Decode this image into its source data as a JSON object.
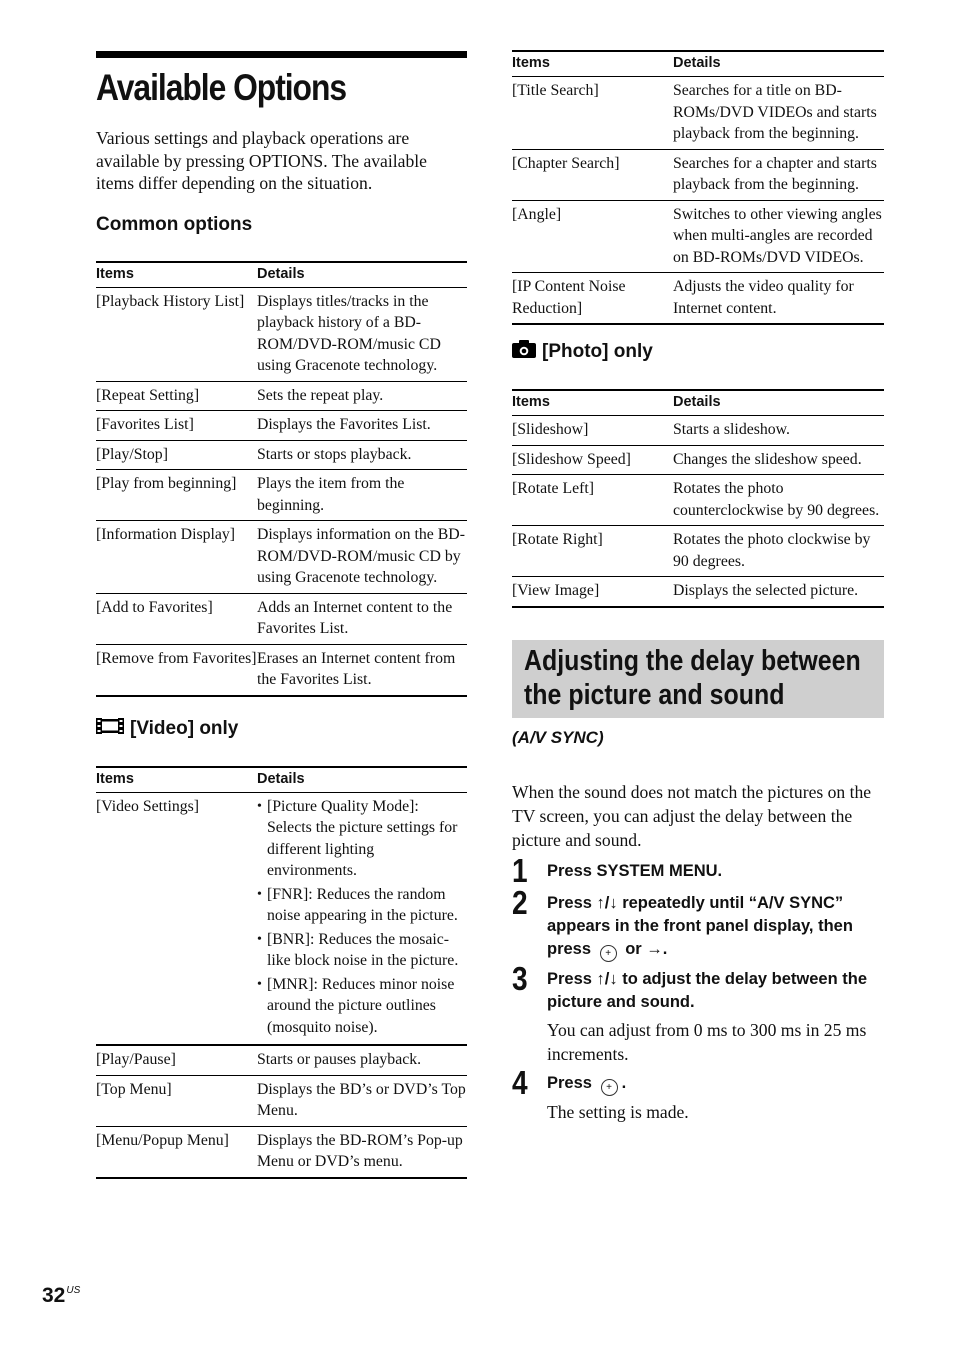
{
  "page": {
    "title": "Available Options",
    "intro": "Various settings and playback operations are available by pressing OPTIONS. The available items differ depending on the situation.",
    "page_number": "32",
    "page_region": "US"
  },
  "common_options": {
    "heading": "Common options",
    "headers": {
      "items": "Items",
      "details": "Details"
    },
    "rows": [
      {
        "item": "[Playback History List]",
        "details": "Displays titles/tracks in the playback history of a BD-ROM/DVD-ROM/music CD using Gracenote technology."
      },
      {
        "item": "[Repeat Setting]",
        "details": "Sets the repeat play."
      },
      {
        "item": "[Favorites List]",
        "details": "Displays the Favorites List."
      },
      {
        "item": "[Play/Stop]",
        "details": "Starts or stops playback."
      },
      {
        "item": "[Play from beginning]",
        "details": "Plays the item from the beginning."
      },
      {
        "item": "[Information Display]",
        "details": "Displays information on the BD-ROM/DVD-ROM/music CD by using Gracenote technology."
      },
      {
        "item": "[Add to Favorites]",
        "details": "Adds an Internet content to the Favorites List."
      },
      {
        "item": "[Remove from Favorites]",
        "details": "Erases an Internet content from the Favorites List."
      }
    ]
  },
  "video_only": {
    "heading": "[Video] only",
    "icon": "film-icon",
    "headers": {
      "items": "Items",
      "details": "Details"
    },
    "video_settings": {
      "item": "[Video Settings]",
      "bullets": [
        "[Picture Quality Mode]: Selects the picture settings for different lighting environments.",
        "[FNR]: Reduces the random noise appearing in the picture.",
        "[BNR]: Reduces the mosaic-like block noise in the picture.",
        "[MNR]: Reduces minor noise around the picture outlines (mosquito noise)."
      ]
    },
    "rows": [
      {
        "item": "[Play/Pause]",
        "details": "Starts or pauses playback."
      },
      {
        "item": "[Top Menu]",
        "details": "Displays the BD’s or DVD’s Top Menu."
      },
      {
        "item": "[Menu/Popup Menu]",
        "details": "Displays the BD-ROM’s Pop-up Menu or DVD’s menu."
      }
    ]
  },
  "video_only_continued": {
    "headers": {
      "items": "Items",
      "details": "Details"
    },
    "rows": [
      {
        "item": "[Title Search]",
        "details": "Searches for a title on BD-ROMs/DVD VIDEOs and starts playback from the beginning."
      },
      {
        "item": "[Chapter Search]",
        "details": "Searches for a chapter and starts playback from the beginning."
      },
      {
        "item": "[Angle]",
        "details": "Switches to other viewing angles when multi-angles are recorded on BD-ROMs/DVD VIDEOs."
      },
      {
        "item": "[IP Content Noise Reduction]",
        "details": "Adjusts the video quality for Internet content."
      }
    ]
  },
  "photo_only": {
    "heading": "[Photo] only",
    "icon": "camera-icon",
    "headers": {
      "items": "Items",
      "details": "Details"
    },
    "rows": [
      {
        "item": "[Slideshow]",
        "details": "Starts a slideshow."
      },
      {
        "item": "[Slideshow Speed]",
        "details": "Changes the slideshow speed."
      },
      {
        "item": "[Rotate Left]",
        "details": "Rotates the photo counterclockwise by 90 degrees."
      },
      {
        "item": "[Rotate Right]",
        "details": "Rotates the photo clockwise by 90 degrees."
      },
      {
        "item": "[View Image]",
        "details": "Displays the selected picture."
      }
    ]
  },
  "av_sync": {
    "banner_line1": "Adjusting the delay between",
    "banner_line2": "the picture and sound",
    "subtitle": "(A/V SYNC)",
    "intro": "When the sound does not match the pictures on the TV screen, you can adjust the delay between the picture and sound.",
    "steps": [
      {
        "num": "1",
        "text_a": "Press SYSTEM MENU."
      },
      {
        "num": "2",
        "text_a": "Press ↑/↓ repeatedly until “A/V SYNC” appears in the front panel display, then press",
        "text_b": "or →."
      },
      {
        "num": "3",
        "text_a": "Press ↑/↓ to adjust the delay between the picture and sound.",
        "note": "You can adjust from 0 ms to 300 ms in 25 ms increments."
      },
      {
        "num": "4",
        "text_a": "Press",
        "text_b": ".",
        "note": "The setting is made."
      }
    ],
    "enter_icon_glyph": "+"
  }
}
